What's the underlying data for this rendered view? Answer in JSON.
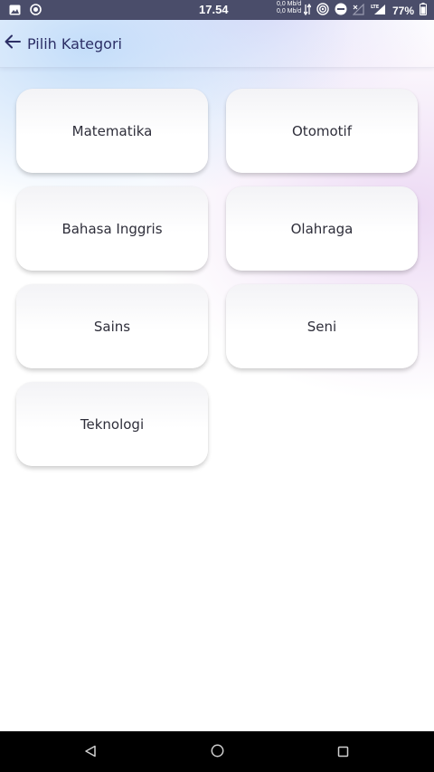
{
  "status_bar": {
    "time": "17.54",
    "net_up": "0,0 Mb/d",
    "net_down": "0,0 Mb/d",
    "network_type": "LTE",
    "battery": "77%"
  },
  "app_bar": {
    "title": "Pilih Kategori",
    "back_icon": "arrow-left-icon"
  },
  "categories": [
    "Matematika",
    "Otomotif",
    "Bahasa Inggris",
    "Olahraga",
    "Sains",
    "Seni",
    "Teknologi"
  ],
  "nav_bar": {
    "back": "triangle-back-icon",
    "home": "circle-home-icon",
    "recents": "square-recents-icon"
  },
  "colors": {
    "title": "#2c2f66",
    "status_bar": "#4a4d6a",
    "nav_bar": "#000000"
  }
}
